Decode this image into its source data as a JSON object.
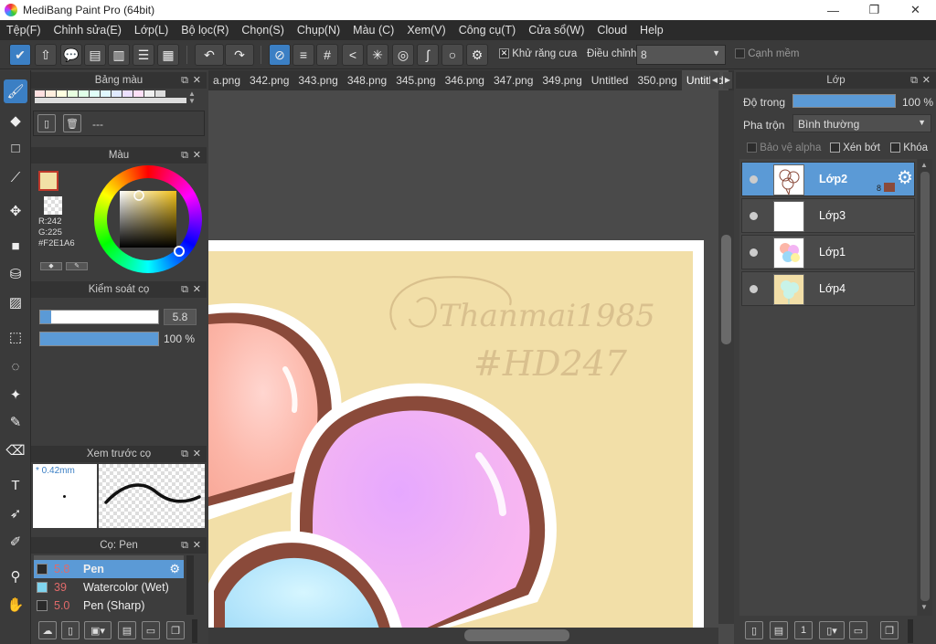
{
  "window": {
    "title": "MediBang Paint Pro (64bit)",
    "minimize": "—",
    "restore": "❐",
    "close": "✕"
  },
  "menu": [
    "Tệp(F)",
    "Chỉnh sửa(E)",
    "Lớp(L)",
    "Bộ lọc(R)",
    "Chọn(S)",
    "Chụp(N)",
    "Màu (C)",
    "Xem(V)",
    "Công cụ(T)",
    "Cửa sổ(W)",
    "Cloud",
    "Help"
  ],
  "toolbar": {
    "antialias_label": "Khử răng cưa",
    "adjust_label": "Điều chỉnh",
    "adjust_value": "8",
    "soft_edge_label": "Cạnh mềm"
  },
  "palette_panel": {
    "title": "Bảng màu",
    "dash": "---"
  },
  "color_panel": {
    "title": "Màu",
    "r": "R:242",
    "g": "G:225",
    "hex": "#F2E1A6",
    "primary_color": "#F2E1A6"
  },
  "brush_control": {
    "title": "Kiểm soát cọ",
    "size_value": "5.8",
    "opacity_value": "100 %"
  },
  "brush_preview": {
    "title": "Xem trước cọ",
    "size_label": "* 0.42mm"
  },
  "brush_list": {
    "title": "Cọ: Pen",
    "items": [
      {
        "size": "5.8",
        "name": "Pen",
        "color": "#2a2a2a"
      },
      {
        "size": "39",
        "name": "Watercolor (Wet)",
        "color": "#7fd4ee"
      },
      {
        "size": "5.0",
        "name": "Pen (Sharp)",
        "color": "#2a2a2a"
      }
    ]
  },
  "tabs": [
    "a.png",
    "342.png",
    "343.png",
    "348.png",
    "345.png",
    "346.png",
    "347.png",
    "349.png",
    "Untitled",
    "350.png",
    "Untitled"
  ],
  "canvas": {
    "signature_name": "Thanmai1985",
    "signature_tag": "#HD247"
  },
  "layer_panel": {
    "title": "Lớp",
    "opacity_label": "Độ trong",
    "opacity_value": "100 %",
    "blend_label": "Pha trộn",
    "blend_value": "Bình thường",
    "protect_alpha": "Bảo vệ alpha",
    "clipping": "Xén bớt",
    "lock": "Khóa",
    "layers": [
      {
        "name": "Lớp2",
        "badge": "8"
      },
      {
        "name": "Lớp3"
      },
      {
        "name": "Lớp1"
      },
      {
        "name": "Lớp4"
      }
    ]
  }
}
